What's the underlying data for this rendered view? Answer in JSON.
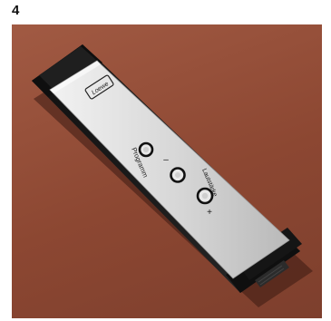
{
  "figure_number": "4",
  "image": {
    "subject": "remote-control",
    "background_color": "#8c4732",
    "labels": {
      "brand": "Loewe",
      "program": "Programm",
      "volume": "Lautstärke",
      "minus": "–",
      "plus": "+"
    },
    "colors": {
      "body_black": "#151515",
      "panel_silver": "#dcdcdc",
      "shadow": "#3a1a12"
    }
  }
}
